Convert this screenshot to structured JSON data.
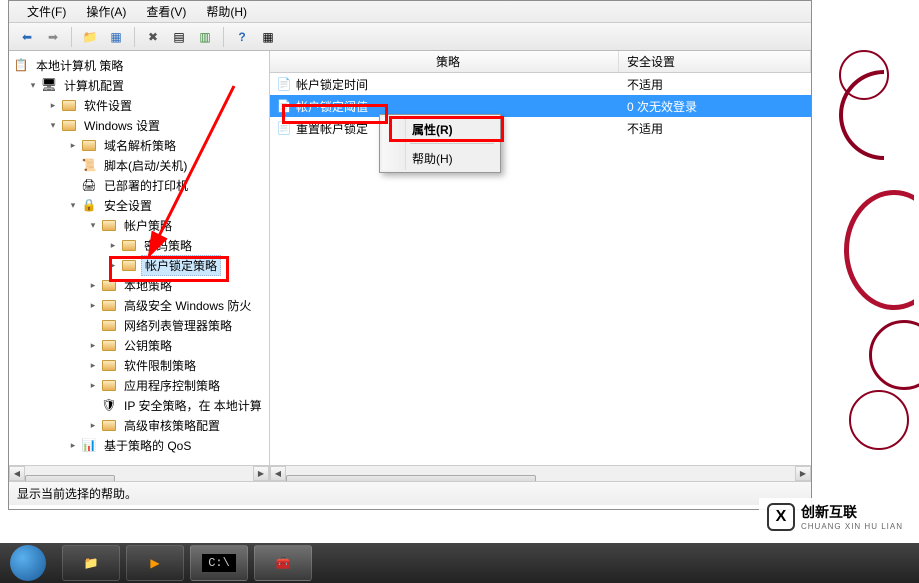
{
  "menubar": {
    "file": "文件(F)",
    "action": "操作(A)",
    "view": "查看(V)",
    "help": "帮助(H)"
  },
  "tree": {
    "root": "本地计算机 策略",
    "computer_config": "计算机配置",
    "software_settings": "软件设置",
    "windows_settings": "Windows 设置",
    "domain_resolution": "域名解析策略",
    "scripts": "脚本(启动/关机)",
    "deployed_printers": "已部署的打印机",
    "security_settings": "安全设置",
    "account_policies": "帐户策略",
    "password_policy": "密码策略",
    "account_lockout_policy": "帐户锁定策略",
    "local_policies": "本地策略",
    "windows_firewall": "高级安全 Windows 防火",
    "network_list": "网络列表管理器策略",
    "public_key": "公钥策略",
    "software_restriction": "软件限制策略",
    "app_control": "应用程序控制策略",
    "ip_security": "IP 安全策略，在 本地计算",
    "advanced_audit": "高级审核策略配置",
    "qos": "基于策略的 QoS"
  },
  "list": {
    "col_policy": "策略",
    "col_setting": "安全设置",
    "rows": [
      {
        "name": "帐户锁定时间",
        "value": "不适用"
      },
      {
        "name": "帐户锁定阈值",
        "value": "0 次无效登录"
      },
      {
        "name": "重置帐户锁定",
        "value": "不适用"
      }
    ]
  },
  "context_menu": {
    "properties": "属性(R)",
    "help": "帮助(H)"
  },
  "statusbar": {
    "text": "显示当前选择的帮助。"
  },
  "watermark": {
    "brand": "创新互联",
    "sub": "CHUANG XIN HU LIAN"
  }
}
